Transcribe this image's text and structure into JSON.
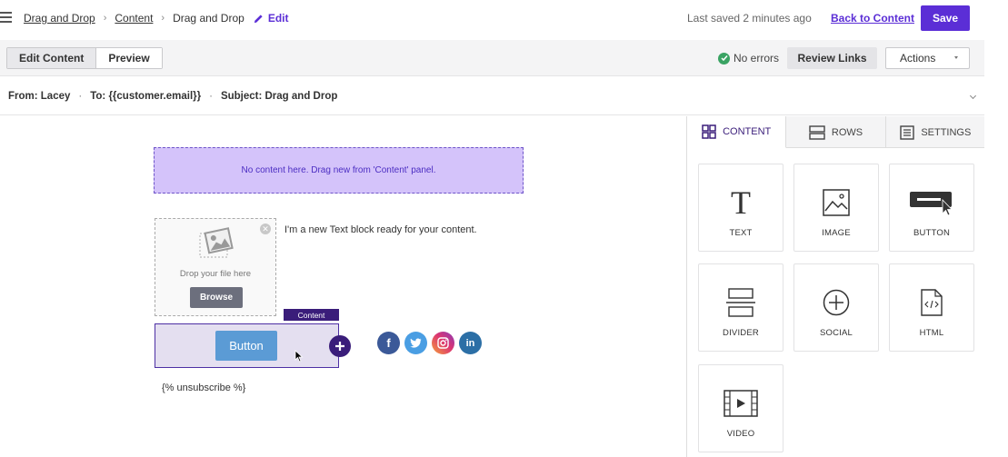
{
  "breadcrumb": {
    "items": [
      "Drag and Drop",
      "Content"
    ],
    "current": "Drag and Drop",
    "edit_label": "Edit"
  },
  "header": {
    "last_saved": "Last saved 2 minutes ago",
    "back_link": "Back to Content",
    "save_label": "Save"
  },
  "toolbar": {
    "edit_content": "Edit Content",
    "preview": "Preview",
    "no_errors": "No errors",
    "review_links": "Review Links",
    "actions": "Actions"
  },
  "email": {
    "from": "From: Lacey",
    "to": "To: {{customer.email}}",
    "subject": "Subject: Drag and Drop"
  },
  "canvas": {
    "dropzone_text": "No content here. Drag new from 'Content' panel.",
    "drop_file_label": "Drop your file here",
    "browse_label": "Browse",
    "text_block": "I'm a new Text block ready for your content.",
    "content_tag": "Content",
    "button_label": "Button",
    "unsubscribe": "{% unsubscribe %}",
    "social_icons": [
      "facebook-icon",
      "twitter-icon",
      "instagram-icon",
      "linkedin-icon"
    ]
  },
  "panel": {
    "tabs": [
      {
        "label": "CONTENT",
        "icon": "grid-icon"
      },
      {
        "label": "ROWS",
        "icon": "rows-icon"
      },
      {
        "label": "SETTINGS",
        "icon": "settings-icon"
      }
    ],
    "tiles": [
      {
        "label": "TEXT",
        "icon": "text-icon"
      },
      {
        "label": "IMAGE",
        "icon": "image-icon"
      },
      {
        "label": "BUTTON",
        "icon": "button-icon"
      },
      {
        "label": "DIVIDER",
        "icon": "divider-icon"
      },
      {
        "label": "SOCIAL",
        "icon": "social-plus-icon"
      },
      {
        "label": "HTML",
        "icon": "html-file-icon"
      },
      {
        "label": "VIDEO",
        "icon": "video-icon"
      }
    ]
  },
  "colors": {
    "accent": "#5b2ed6",
    "dropzone_bg": "#d4c3fa",
    "handle": "#3a1d7a",
    "button_blue": "#5b9bd5",
    "success": "#3aa363"
  }
}
